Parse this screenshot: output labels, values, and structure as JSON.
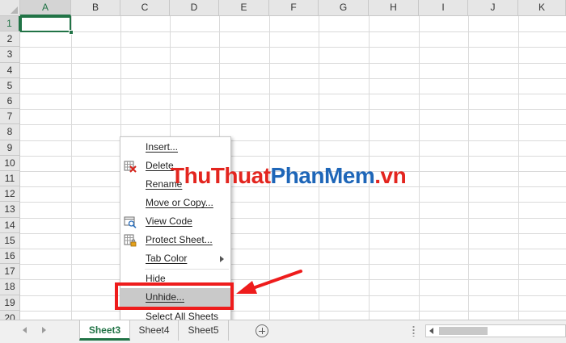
{
  "columns": [
    "A",
    "B",
    "C",
    "D",
    "E",
    "F",
    "G",
    "H",
    "I",
    "J",
    "K"
  ],
  "rows": [
    "1",
    "2",
    "3",
    "4",
    "5",
    "6",
    "7",
    "8",
    "9",
    "10",
    "11",
    "12",
    "13",
    "14",
    "15",
    "16",
    "17",
    "18",
    "19",
    "20"
  ],
  "active_cell": "A1",
  "context_menu": {
    "items": [
      {
        "label": "Insert...",
        "icon": "none"
      },
      {
        "label": "Delete",
        "icon": "delete-sheet-icon"
      },
      {
        "label": "Rename",
        "icon": "none"
      },
      {
        "label": "Move or Copy...",
        "icon": "none"
      },
      {
        "label": "View Code",
        "icon": "view-code-icon"
      },
      {
        "label": "Protect Sheet...",
        "icon": "protect-sheet-icon"
      },
      {
        "label": "Tab Color",
        "icon": "none",
        "submenu": true
      },
      {
        "label": "Hide",
        "icon": "none"
      },
      {
        "label": "Unhide...",
        "icon": "none",
        "highlighted": true
      },
      {
        "label": "Select All Sheets",
        "icon": "none"
      }
    ]
  },
  "watermark": {
    "part1": "ThuThuat",
    "part2": "PhanMem",
    "part3": ".vn"
  },
  "sheet_tabs": [
    {
      "label": "Sheet3",
      "active": true
    },
    {
      "label": "Sheet4",
      "active": false
    },
    {
      "label": "Sheet5",
      "active": false
    }
  ],
  "colors": {
    "excel_green": "#217346",
    "annotation_red": "#ee1c1c",
    "watermark_red": "#e3251f",
    "watermark_blue": "#1e66b8"
  }
}
